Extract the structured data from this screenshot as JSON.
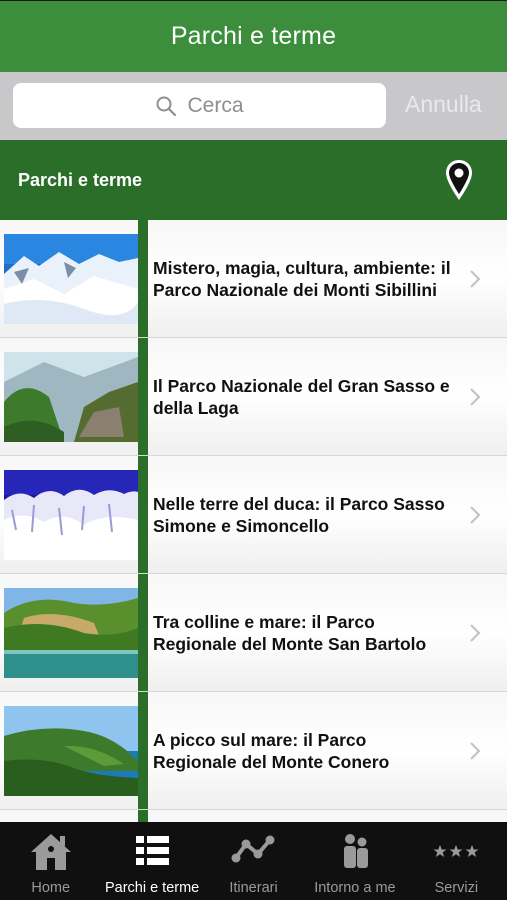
{
  "nav": {
    "title": "Parchi e terme"
  },
  "search": {
    "placeholder": "Cerca",
    "cancel_label": "Annulla"
  },
  "section": {
    "title": "Parchi e terme"
  },
  "items": [
    {
      "title": "Mistero, magia, cultura, ambiente: il Parco Nazionale dei Monti Sibillini"
    },
    {
      "title": "Il Parco Nazionale del Gran Sasso e della Laga"
    },
    {
      "title": "Nelle terre del duca: il Parco Sasso Simone e Simoncello"
    },
    {
      "title": "Tra colline e mare: il Parco Regionale del Monte San Bartolo"
    },
    {
      "title": "A picco sul mare: il Parco Regionale del Monte Conero"
    }
  ],
  "tabs": [
    {
      "label": "Home",
      "icon": "home-icon"
    },
    {
      "label": "Parchi e terme",
      "icon": "list-icon"
    },
    {
      "label": "Itinerari",
      "icon": "route-icon"
    },
    {
      "label": "Intorno a me",
      "icon": "people-icon"
    },
    {
      "label": "Servizi",
      "icon": "stars-icon"
    }
  ],
  "colors": {
    "primary_green": "#3c8e3c",
    "dark_green": "#2a6e2a",
    "tab_bar": "#101010"
  }
}
